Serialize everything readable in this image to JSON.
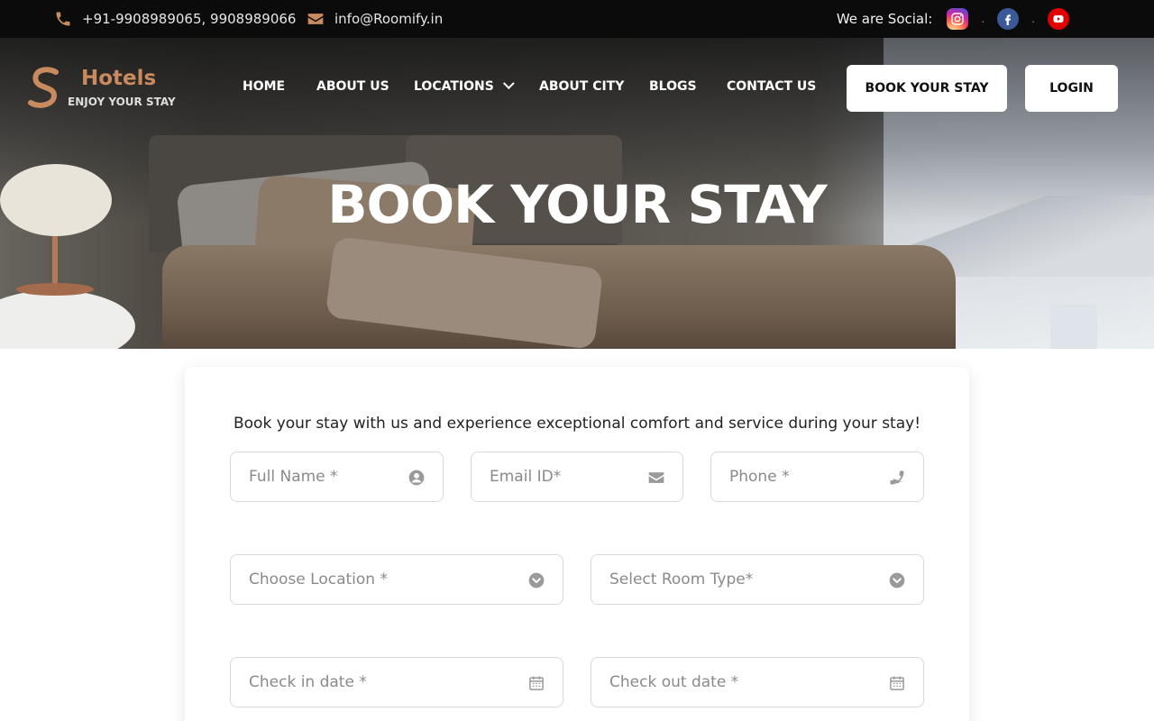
{
  "topbar": {
    "phone": "+91-9908989065, 9908989066",
    "email": "info@Roomify.in",
    "social_label": "We are Social:",
    "social_sep": "."
  },
  "brand": {
    "title": "Hotels",
    "tagline": "ENJOY YOUR STAY",
    "accent_color": "#c98a5e"
  },
  "nav": {
    "items": [
      {
        "label": "HOME"
      },
      {
        "label": "ABOUT US"
      },
      {
        "label": "LOCATIONS"
      },
      {
        "label": "ABOUT CITY"
      },
      {
        "label": "BLOGS"
      },
      {
        "label": "CONTACT US"
      }
    ],
    "book_button": "BOOK YOUR STAY",
    "login_button": "LOGIN"
  },
  "hero": {
    "title": "BOOK YOUR STAY"
  },
  "form": {
    "intro": "Book your stay with us and experience exceptional comfort and service during your stay!",
    "full_name": "Full Name *",
    "email": "Email ID*",
    "phone": "Phone *",
    "location": "Choose Location *",
    "room_type": "Select Room Type*",
    "check_in": "Check in date *",
    "check_out": "Check out date *"
  },
  "icons": {
    "phone": "phone-icon",
    "email": "envelope-icon",
    "instagram": "instagram-icon",
    "facebook": "facebook-icon",
    "youtube": "youtube-icon",
    "user": "user-circle-icon",
    "dropdown": "chevron-circle-icon",
    "calendar": "calendar-icon"
  }
}
